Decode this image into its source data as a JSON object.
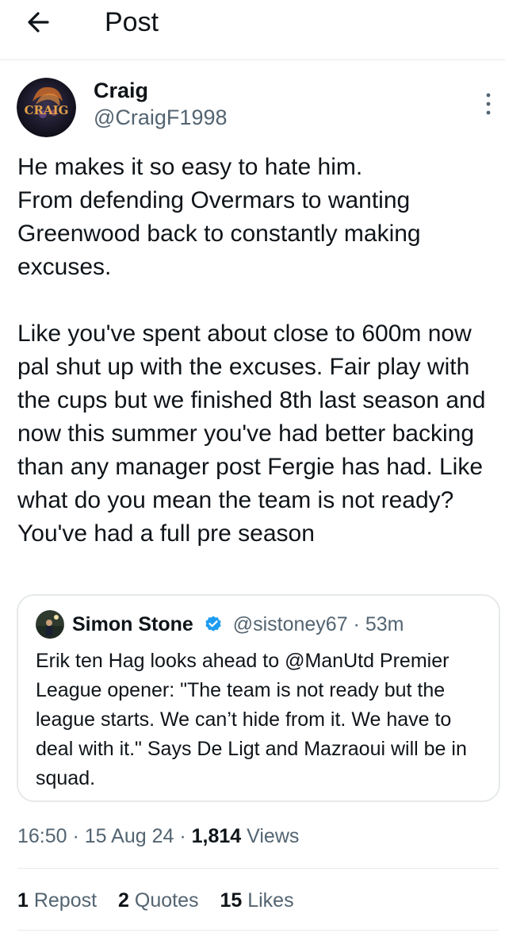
{
  "header": {
    "title": "Post"
  },
  "author": {
    "name": "Craig",
    "handle": "@CraigF1998",
    "avatar_text": "CRAIG"
  },
  "tweet": {
    "text": "He makes it so easy to hate him.\nFrom defending Overmars to wanting Greenwood back to constantly making excuses.\n\nLike you've spent about close to 600m now pal shut up with the excuses. Fair play with the cups but we finished 8th last season and now this summer you've had better backing than any manager post Fergie has had. Like what do you mean the team is not ready? You've had a full pre season"
  },
  "quote": {
    "name": "Simon Stone",
    "handle": "@sistoney67",
    "sep": " · ",
    "time": "53m",
    "text": "Erik ten Hag looks ahead to @ManUtd Premier League opener: \"The team is not ready but the league starts. We can’t hide from it. We have to deal with it.\" Says De Ligt and Mazraoui will be in squad."
  },
  "meta": {
    "time": "16:50",
    "sep": " · ",
    "date": "15 Aug 24",
    "views_count": "1,814",
    "views_label": " Views"
  },
  "stats": {
    "reposts_count": "1",
    "reposts_label": " Repost",
    "quotes_count": "2",
    "quotes_label": " Quotes",
    "likes_count": "15",
    "likes_label": " Likes"
  },
  "colors": {
    "text": "#0f1419",
    "secondary": "#536471",
    "border": "#e6e9eb",
    "verified": "#1d9bf0"
  },
  "icons": [
    "arrow-left-icon",
    "more-vertical-icon",
    "verified-badge-icon"
  ]
}
